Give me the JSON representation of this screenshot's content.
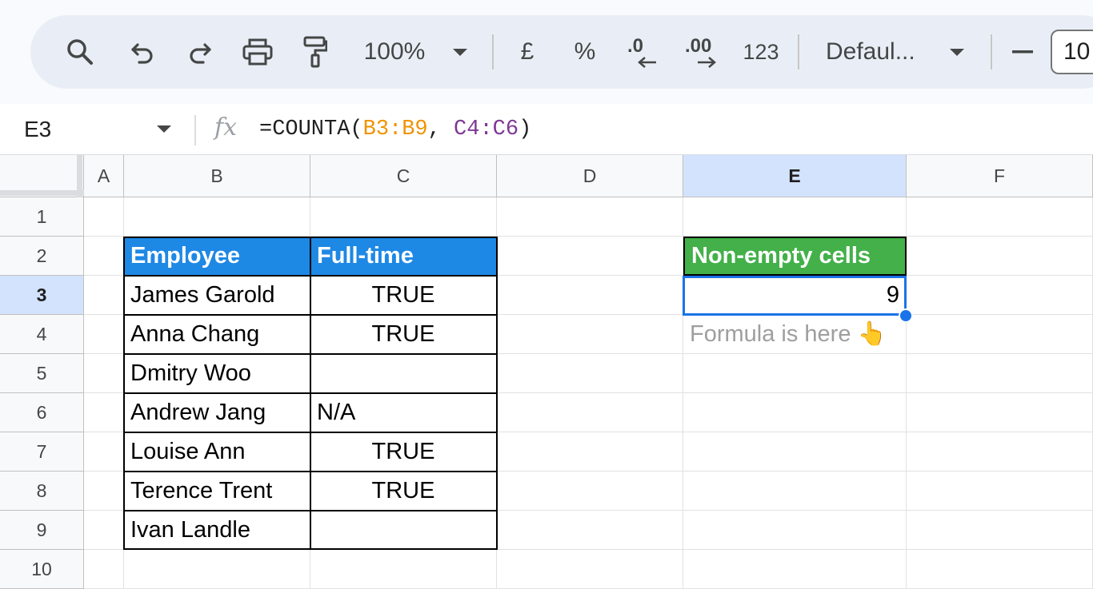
{
  "toolbar": {
    "zoom": "100%",
    "currency": "£",
    "percent": "%",
    "decrease_decimal": ".0",
    "increase_decimal": ".00",
    "more_formats": "123",
    "font": "Defaul...",
    "minus": "−",
    "font_size": "10"
  },
  "formula_bar": {
    "cell_ref": "E3",
    "fx": "fx",
    "formula_prefix": "=COUNTA(",
    "range1": "B3:B9",
    "separator": ", ",
    "range2": "C4:C6",
    "formula_suffix": ")"
  },
  "columns": [
    "A",
    "B",
    "C",
    "D",
    "E",
    "F"
  ],
  "rows": [
    "1",
    "2",
    "3",
    "4",
    "5",
    "6",
    "7",
    "8",
    "9",
    "10"
  ],
  "table": {
    "headers": [
      "Employee",
      "Full-time"
    ],
    "rows": [
      [
        "James Garold",
        "TRUE"
      ],
      [
        "Anna Chang",
        "TRUE"
      ],
      [
        "Dmitry Woo",
        ""
      ],
      [
        "Andrew Jang",
        "N/A"
      ],
      [
        "Louise Ann",
        "TRUE"
      ],
      [
        "Terence Trent",
        "TRUE"
      ],
      [
        "Ivan Landle",
        ""
      ]
    ]
  },
  "result": {
    "header": "Non-empty cells",
    "value": "9",
    "hint": "Formula is here 👆"
  },
  "colors": {
    "header_blue": "#1e88e5",
    "header_green": "#43b049",
    "selection": "#1a73e8"
  }
}
